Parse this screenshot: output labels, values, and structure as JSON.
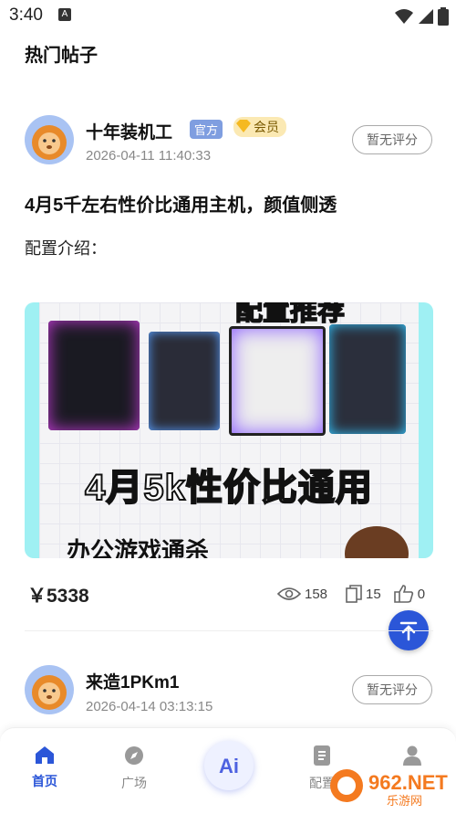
{
  "status_bar": {
    "time": "3:40"
  },
  "section_title": "热门帖子",
  "posts": [
    {
      "author": "十年装机工",
      "badge_official": "官方",
      "badge_member": "会员",
      "time": "2026-04-11 11:40:33",
      "rating": "暂无评分",
      "title": "4月5千左右性价比通用主机，颜值侧透",
      "description": "配置介绍：",
      "cover": {
        "headline": "4月5k性价比通用",
        "sub": "办公游戏通杀",
        "top_text": "配置推荐"
      },
      "price": "￥5338",
      "views": "158",
      "copies": "15",
      "likes": "0"
    },
    {
      "author": "来造1PKm1",
      "time": "2026-04-14 03:13:15",
      "rating": "暂无评分"
    }
  ],
  "tabbar": {
    "items": [
      {
        "label": "首页",
        "icon": "home-icon",
        "active": true
      },
      {
        "label": "广场",
        "icon": "compass-icon",
        "active": false
      },
      {
        "label": "",
        "icon": "ai-icon",
        "active": false
      },
      {
        "label": "配置",
        "icon": "document-icon",
        "active": false
      },
      {
        "label": "",
        "icon": "user-icon",
        "active": false
      }
    ]
  },
  "watermark": {
    "text": "962.NET",
    "sub": "乐游网"
  },
  "colors": {
    "accent": "#2b56d8",
    "official_badge": "#7f9ee0",
    "member_badge": "#fbe9b3"
  }
}
